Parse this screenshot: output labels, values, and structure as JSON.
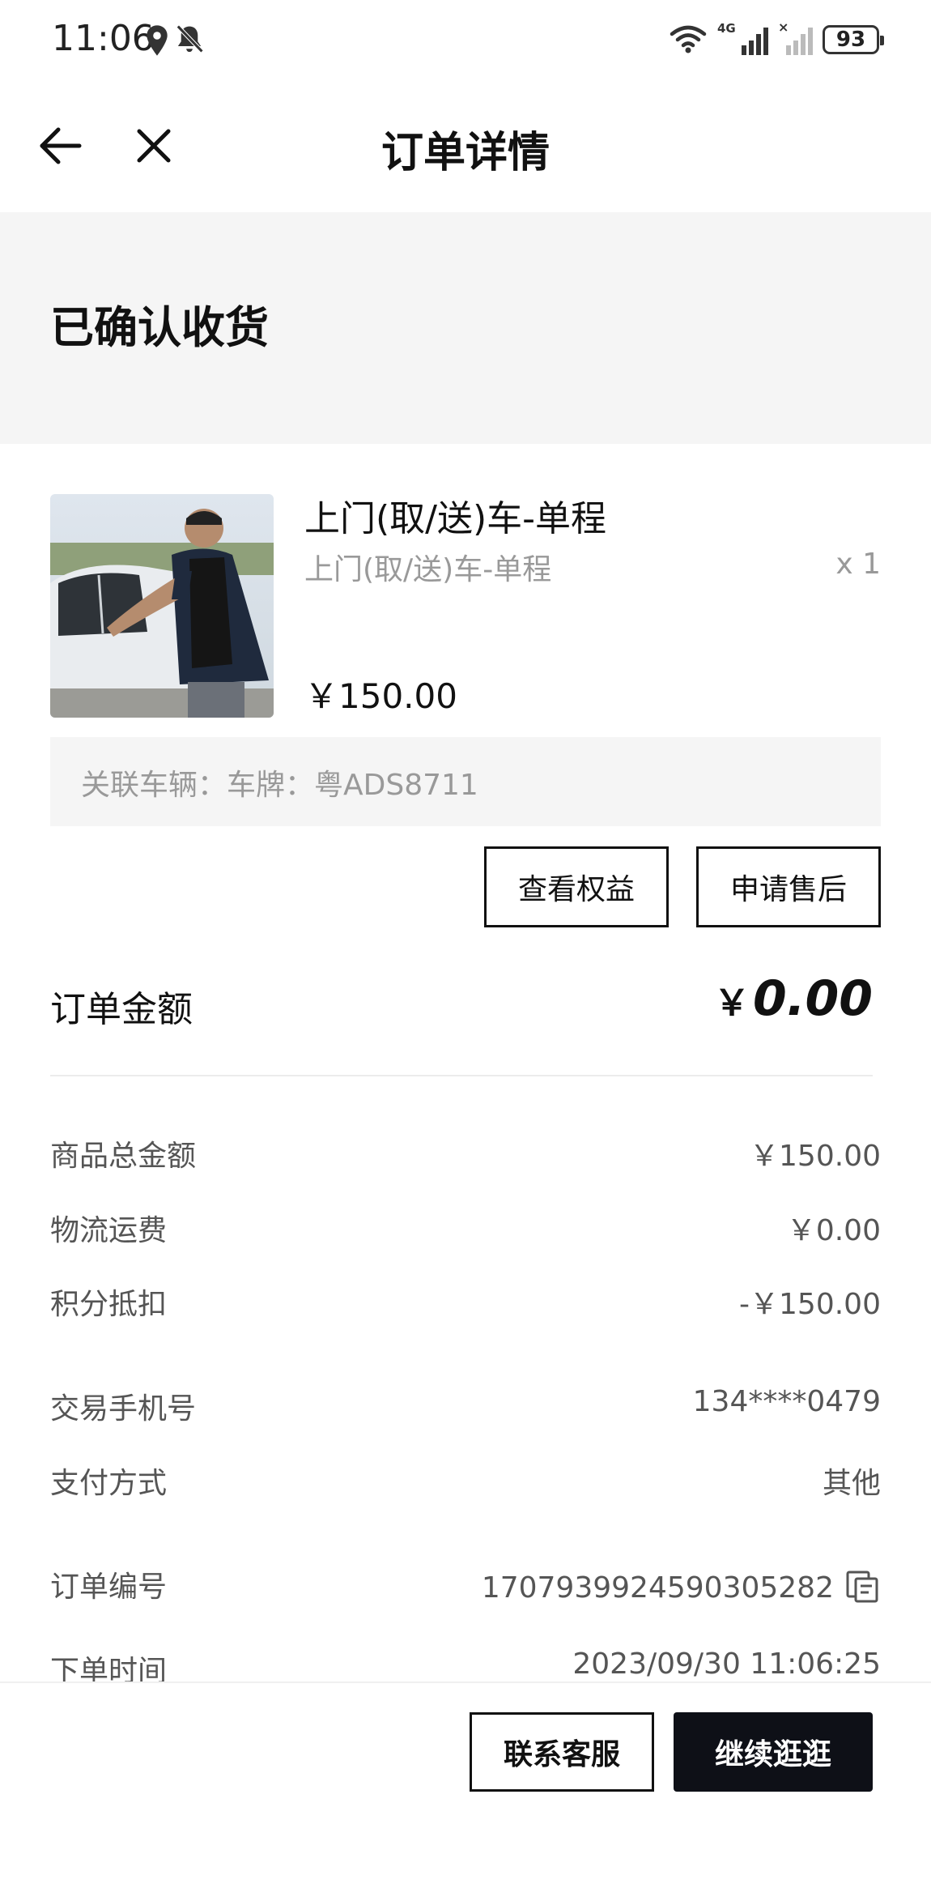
{
  "status_bar": {
    "time": "11:06",
    "network": "4G",
    "battery": "93",
    "icons": [
      "location-icon",
      "bell-off-icon",
      "wifi-icon",
      "signal-icon",
      "signal-weak-icon",
      "battery-icon"
    ]
  },
  "nav": {
    "title": "订单详情",
    "back_icon": "arrow-left-icon",
    "close_icon": "close-icon"
  },
  "order_status": "已确认收货",
  "product": {
    "title": "上门(取/送)车-单程",
    "subtitle": "上门(取/送)车-单程",
    "quantity": "x 1",
    "price": "￥150.00",
    "vehicle": "关联车辆：车牌：粤ADS8711"
  },
  "actions": {
    "view_benefits": "查看权益",
    "apply_aftersale": "申请售后"
  },
  "order_amount": {
    "label": "订单金额",
    "currency": "￥",
    "value": "0.00"
  },
  "breakdown": [
    {
      "label": "商品总金额",
      "value": "￥150.00"
    },
    {
      "label": "物流运费",
      "value": "￥0.00"
    },
    {
      "label": "积分抵扣",
      "value": "-￥150.00"
    }
  ],
  "details": [
    {
      "label": "交易手机号",
      "value": "134****0479"
    },
    {
      "label": "支付方式",
      "value": "其他"
    },
    {
      "label": "订单编号",
      "value": "1707939924590305282"
    },
    {
      "label": "下单时间",
      "value": "2023/09/30 11:06:25"
    }
  ],
  "bottom": {
    "contact_service": "联系客服",
    "continue_shopping": "继续逛逛"
  },
  "colors": {
    "primary_dark": "#0e1017",
    "banner_bg": "#f5f5f5",
    "muted_text": "#999999"
  }
}
